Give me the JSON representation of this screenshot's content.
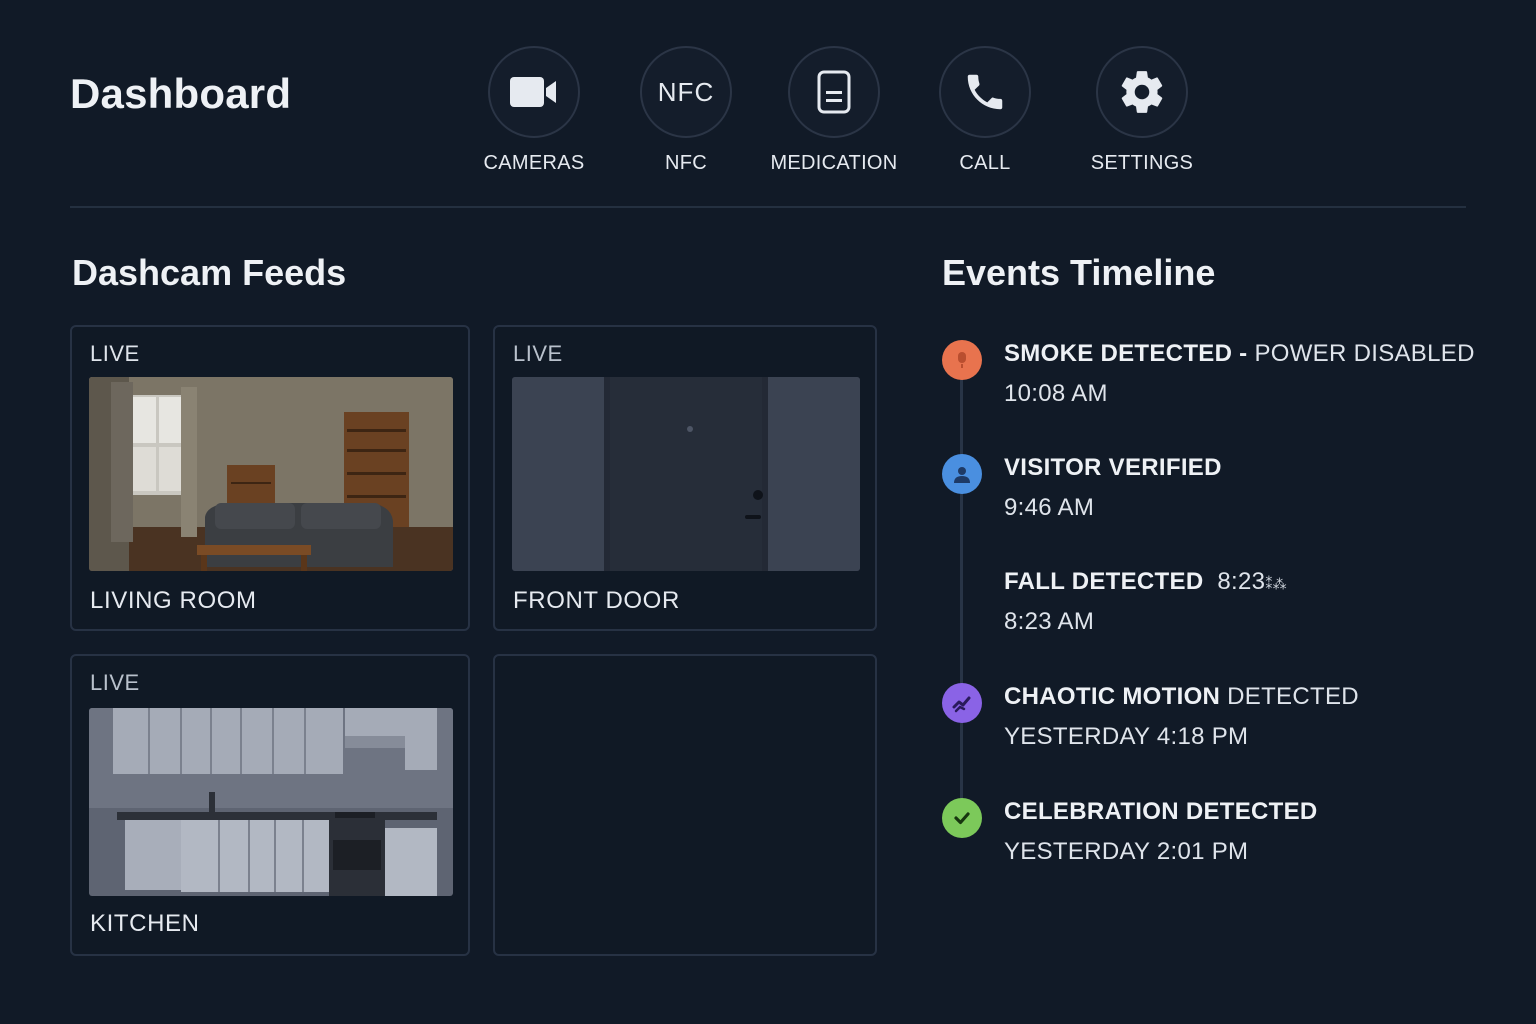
{
  "header": {
    "title": "Dashboard"
  },
  "nav": {
    "items": [
      {
        "label": "CAMERAS",
        "icon": "video-camera-icon"
      },
      {
        "label": "NFC",
        "icon": "nfc-icon",
        "icon_text": "NFC"
      },
      {
        "label": "MEDICATION",
        "icon": "medication-icon"
      },
      {
        "label": "CALL",
        "icon": "phone-icon"
      },
      {
        "label": "SETTINGS",
        "icon": "gear-icon"
      }
    ]
  },
  "feeds": {
    "title": "Dashcam Feeds",
    "cards": [
      {
        "tag": "LIVE",
        "name": "LIVING ROOM"
      },
      {
        "tag": "LIVE",
        "name": "FRONT DOOR"
      },
      {
        "tag": "LIVE",
        "name": "KITCHEN"
      }
    ]
  },
  "timeline": {
    "title": "Events Timeline",
    "events": [
      {
        "title_strong": "SMOKE DETECTED - ",
        "title_light": "POWER DISABLED",
        "time": "10:08 AM",
        "color": "#e8734e",
        "icon": "alert-icon"
      },
      {
        "title_strong": "VISITOR VERIFIED",
        "title_light": "",
        "time": "9:46 AM",
        "color": "#4a8fe0",
        "icon": "person-icon"
      },
      {
        "title_strong": "FALL DETECTED",
        "title_light": "8:23",
        "glyphs": "⁑⁂",
        "time": "8:23 AM",
        "color": "",
        "icon": ""
      },
      {
        "title_strong": "CHAOTIC MOTION",
        "title_light": " DETECTED",
        "time": "YESTERDAY 4:18 PM",
        "color": "#8a63e6",
        "icon": "motion-icon"
      },
      {
        "title_strong": "CELEBRATION DETECTED",
        "title_light": "",
        "time": "YESTERDAY 2:01 PM",
        "color": "#7cc95a",
        "icon": "check-icon"
      }
    ]
  }
}
